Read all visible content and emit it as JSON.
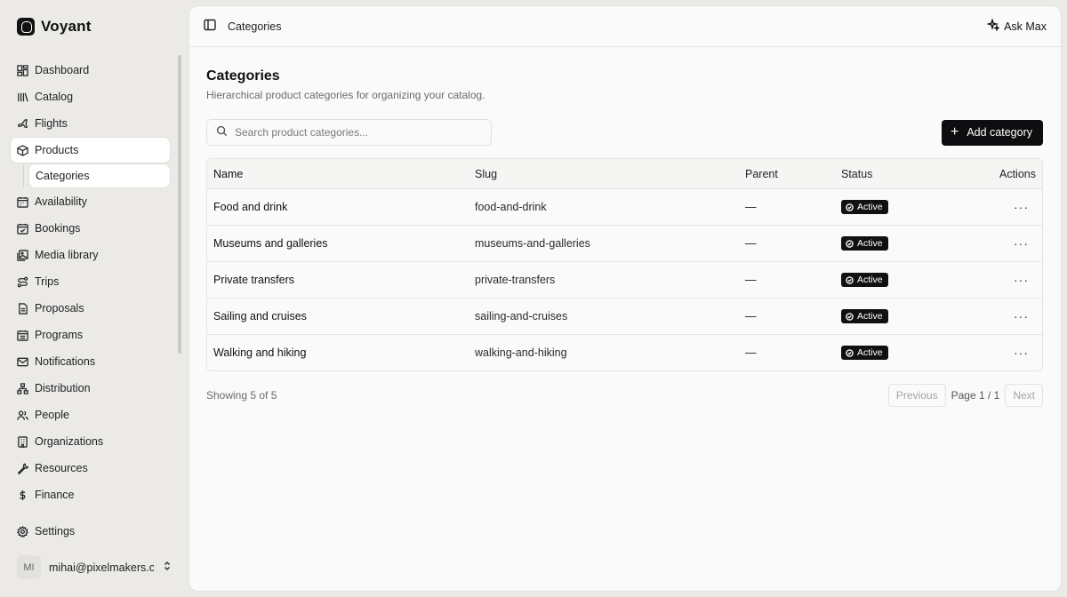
{
  "brand": {
    "name": "Voyant"
  },
  "sidebar": {
    "items": [
      {
        "label": "Dashboard",
        "icon": "dashboard-icon",
        "active": false
      },
      {
        "label": "Catalog",
        "icon": "catalog-icon",
        "active": false
      },
      {
        "label": "Flights",
        "icon": "plane-icon",
        "active": false
      },
      {
        "label": "Products",
        "icon": "package-icon",
        "active": true
      },
      {
        "label": "Categories",
        "icon": "",
        "active": true,
        "sub": true
      },
      {
        "label": "Availability",
        "icon": "calendar-grid-icon",
        "active": false
      },
      {
        "label": "Bookings",
        "icon": "calendar-check-icon",
        "active": false
      },
      {
        "label": "Media library",
        "icon": "images-icon",
        "active": false
      },
      {
        "label": "Trips",
        "icon": "route-icon",
        "active": false
      },
      {
        "label": "Proposals",
        "icon": "file-text-icon",
        "active": false
      },
      {
        "label": "Programs",
        "icon": "calendar-days-icon",
        "active": false
      },
      {
        "label": "Notifications",
        "icon": "mail-icon",
        "active": false
      },
      {
        "label": "Distribution",
        "icon": "network-icon",
        "active": false
      },
      {
        "label": "People",
        "icon": "users-icon",
        "active": false
      },
      {
        "label": "Organizations",
        "icon": "building-icon",
        "active": false
      },
      {
        "label": "Resources",
        "icon": "wrench-icon",
        "active": false
      },
      {
        "label": "Finance",
        "icon": "dollar-icon",
        "active": false
      }
    ],
    "settings_label": "Settings",
    "user": {
      "initials": "MI",
      "email": "mihai@pixelmakers.c..."
    }
  },
  "topbar": {
    "title": "Categories",
    "ask_label": "Ask Max"
  },
  "page": {
    "title": "Categories",
    "subtitle": "Hierarchical product categories for organizing your catalog.",
    "search_placeholder": "Search product categories...",
    "add_label": "Add category"
  },
  "table": {
    "headers": {
      "name": "Name",
      "slug": "Slug",
      "parent": "Parent",
      "status": "Status",
      "actions": "Actions"
    },
    "rows": [
      {
        "name": "Food and drink",
        "slug": "food-and-drink",
        "parent": "—",
        "status": "Active"
      },
      {
        "name": "Museums and galleries",
        "slug": "museums-and-galleries",
        "parent": "—",
        "status": "Active"
      },
      {
        "name": "Private transfers",
        "slug": "private-transfers",
        "parent": "—",
        "status": "Active"
      },
      {
        "name": "Sailing and cruises",
        "slug": "sailing-and-cruises",
        "parent": "—",
        "status": "Active"
      },
      {
        "name": "Walking and hiking",
        "slug": "walking-and-hiking",
        "parent": "—",
        "status": "Active"
      }
    ]
  },
  "footer": {
    "showing": "Showing 5 of 5",
    "previous": "Previous",
    "page_info": "Page 1 / 1",
    "next": "Next"
  }
}
